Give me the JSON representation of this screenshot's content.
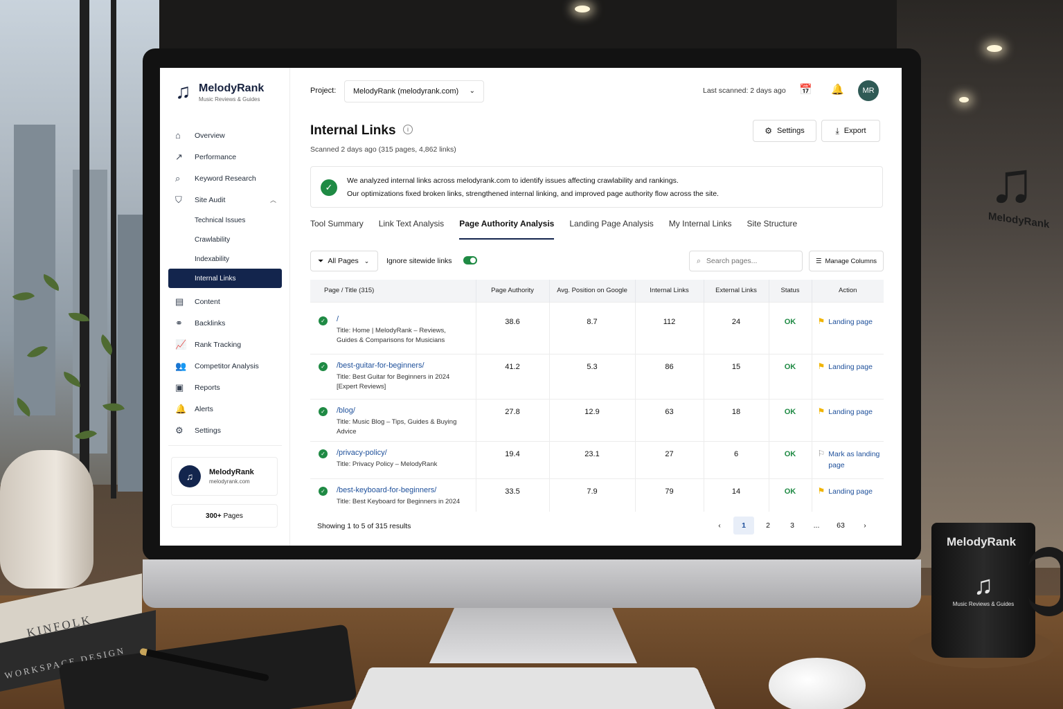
{
  "app": {
    "name": "MelodyRank",
    "tagline": "Music Reviews & Guides"
  },
  "sidebar": {
    "items": [
      {
        "label": "Overview",
        "icon": "home-icon"
      },
      {
        "label": "Performance",
        "icon": "chart-icon"
      },
      {
        "label": "Keyword Research",
        "icon": "search-icon"
      },
      {
        "label": "Site Audit",
        "icon": "shield-icon"
      }
    ],
    "site_audit_sub": [
      {
        "label": "Technical Issues"
      },
      {
        "label": "Crawlability"
      },
      {
        "label": "Indexability"
      },
      {
        "label": "Internal Links"
      }
    ],
    "items_after": [
      {
        "label": "Content",
        "icon": "document-icon"
      },
      {
        "label": "Backlinks",
        "icon": "link-icon"
      },
      {
        "label": "Rank Tracking",
        "icon": "trend-icon"
      },
      {
        "label": "Competitor Analysis",
        "icon": "users-icon"
      },
      {
        "label": "Reports",
        "icon": "report-icon"
      },
      {
        "label": "Alerts",
        "icon": "bell-icon"
      },
      {
        "label": "Settings",
        "icon": "gear-icon"
      }
    ],
    "site_card": {
      "name": "MelodyRank",
      "domain": "melodyrank.com"
    },
    "pages_count": "300+",
    "pages_label": "Pages"
  },
  "topbar": {
    "project_label": "Project:",
    "project_value": "MelodyRank (melodyrank.com)",
    "last_scanned": "Last scanned: 2 days ago",
    "user_initials": "MR"
  },
  "main": {
    "title": "Internal Links",
    "scan_meta": "Scanned 2 days ago  (315 pages, 4,862 links)",
    "settings_label": "Settings",
    "export_label": "Export",
    "notice_line1": "We analyzed internal links across melodyrank.com to identify issues affecting crawlability and rankings.",
    "notice_line2": "Our optimizations fixed broken links, strengthened internal linking, and improved page authority flow across the site.",
    "tabs": [
      {
        "label": "Tool Summary"
      },
      {
        "label": "Link Text Analysis"
      },
      {
        "label": "Page Authority Analysis"
      },
      {
        "label": "Landing Page Analysis"
      },
      {
        "label": "My Internal Links"
      },
      {
        "label": "Site Structure"
      }
    ],
    "active_tab": 2,
    "filter_label": "All Pages",
    "toggle_label": "Ignore sitewide links",
    "toggle_on": true,
    "search_placeholder": "Search pages...",
    "manage_columns_label": "Manage Columns"
  },
  "table": {
    "headers": [
      "Page / Title (315)",
      "Page Authority",
      "Avg. Position on Google",
      "Internal Links",
      "External Links",
      "Status",
      "Action"
    ],
    "rows": [
      {
        "path": "/",
        "title": "Title: Home | MelodyRank – Reviews, Guides & Comparisons for Musicians",
        "authority": "38.6",
        "position": "8.7",
        "internal": "112",
        "external": "24",
        "status": "OK",
        "action": "Landing page",
        "flag": "filled"
      },
      {
        "path": "/best-guitar-for-beginners/",
        "title": "Title: Best Guitar for Beginners in 2024 [Expert Reviews]",
        "authority": "41.2",
        "position": "5.3",
        "internal": "86",
        "external": "15",
        "status": "OK",
        "action": "Landing page",
        "flag": "filled"
      },
      {
        "path": "/blog/",
        "title": "Title: Music Blog – Tips, Guides & Buying Advice",
        "authority": "27.8",
        "position": "12.9",
        "internal": "63",
        "external": "18",
        "status": "OK",
        "action": "Landing page",
        "flag": "filled"
      },
      {
        "path": "/privacy-policy/",
        "title": "Title: Privacy Policy – MelodyRank",
        "authority": "19.4",
        "position": "23.1",
        "internal": "27",
        "external": "6",
        "status": "OK",
        "action": "Mark as landing page",
        "flag": "empty"
      },
      {
        "path": "/best-keyboard-for-beginners/",
        "title": "Title: Best Keyboard for Beginners in 2024",
        "authority": "33.5",
        "position": "7.9",
        "internal": "79",
        "external": "14",
        "status": "OK",
        "action": "Landing page",
        "flag": "filled"
      }
    ]
  },
  "footer": {
    "results_text": "Showing 1 to 5 of 315 results",
    "pages": [
      "1",
      "2",
      "3",
      "...",
      "63"
    ],
    "active_page": "1"
  },
  "background": {
    "wall_logo": "MelodyRank",
    "book1": "KINFOLK",
    "book2": "WORKSPACE DESIGN",
    "mug_brand": "MelodyRank",
    "mug_sub": "Music Reviews & Guides"
  },
  "colors": {
    "accent": "#13254d",
    "link": "#1d4f9a",
    "success": "#1f8a44",
    "flag": "#f0b400"
  }
}
